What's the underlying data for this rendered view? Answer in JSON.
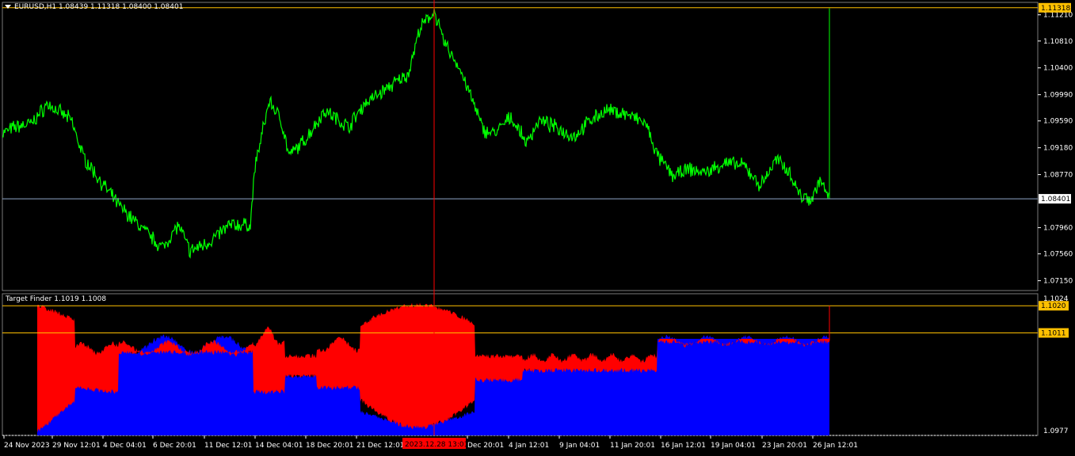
{
  "colors": {
    "background": "#000000",
    "grid": "#7a7a7a",
    "price_line": "#00ff00",
    "current_level": "#8fa5c8",
    "high_level": "#ffc000",
    "crosshair": "#ff0000",
    "target_red": "#ff0000",
    "target_blue": "#0000ff",
    "label_bg": "#ffc000",
    "crosshair_label_bg": "#ff0000"
  },
  "icons": {
    "menu": "triangle-down-icon"
  },
  "main": {
    "title": "EURUSD,H1  1.08439 1.11318 1.08400 1.08401",
    "price_ticks": [
      "1.11210",
      "1.10810",
      "1.10400",
      "1.09990",
      "1.09590",
      "1.09180",
      "1.08770",
      "1.07960",
      "1.07560",
      "1.07150"
    ],
    "high_label": "1.11318",
    "current_label": "1.08401"
  },
  "indicator": {
    "title": "Target Finder 1.1019 1.1008",
    "top_tick": "1.1024",
    "bottom_tick": "1.0977",
    "upper_label": "1.1020",
    "lower_label": "1.1011"
  },
  "time_axis": {
    "labels": [
      "24 Nov 2023",
      "29 Nov 12:01",
      "4 Dec 04:01",
      "6 Dec 20:01",
      "11 Dec 12:01",
      "14 Dec 04:01",
      "18 Dec 20:01",
      "21 Dec 12:01",
      "Dec 20:01",
      "4 Jan 12:01",
      "9 Jan 04:01",
      "11 Jan 20:01",
      "16 Jan 12:01",
      "19 Jan 04:01",
      "23 Jan 20:01",
      "26 Jan 12:01"
    ],
    "crosshair_label": "2023.12.28 13:01"
  },
  "chart_data": {
    "type": "line",
    "symbol": "EURUSD",
    "timeframe": "H1",
    "ohlc_header": {
      "open": 1.08439,
      "high": 1.11318,
      "low": 1.084,
      "close": 1.08401
    },
    "ylim": [
      1.07,
      1.114
    ],
    "series": [
      {
        "name": "EURUSD",
        "x": [
          "24 Nov 2023",
          "29 Nov 12:01",
          "4 Dec 04:01",
          "6 Dec 20:01",
          "11 Dec 12:01",
          "14 Dec 04:01",
          "18 Dec 20:01",
          "21 Dec 12:01",
          "2023.12.28 13:01",
          "Dec 20:01",
          "4 Jan 12:01",
          "9 Jan 04:01",
          "11 Jan 20:01",
          "16 Jan 12:01",
          "19 Jan 04:01",
          "23 Jan 20:01",
          "26 Jan 12:01"
        ],
        "values": [
          1.094,
          1.098,
          1.093,
          1.0765,
          1.078,
          1.089,
          1.0955,
          1.101,
          1.1125,
          1.0925,
          1.0955,
          1.0945,
          1.096,
          1.0875,
          1.0905,
          1.086,
          1.084
        ]
      }
    ],
    "indicator": {
      "name": "Target Finder",
      "ylim": [
        1.0977,
        1.1024
      ],
      "levels": [
        1.102,
        1.1011
      ]
    }
  }
}
